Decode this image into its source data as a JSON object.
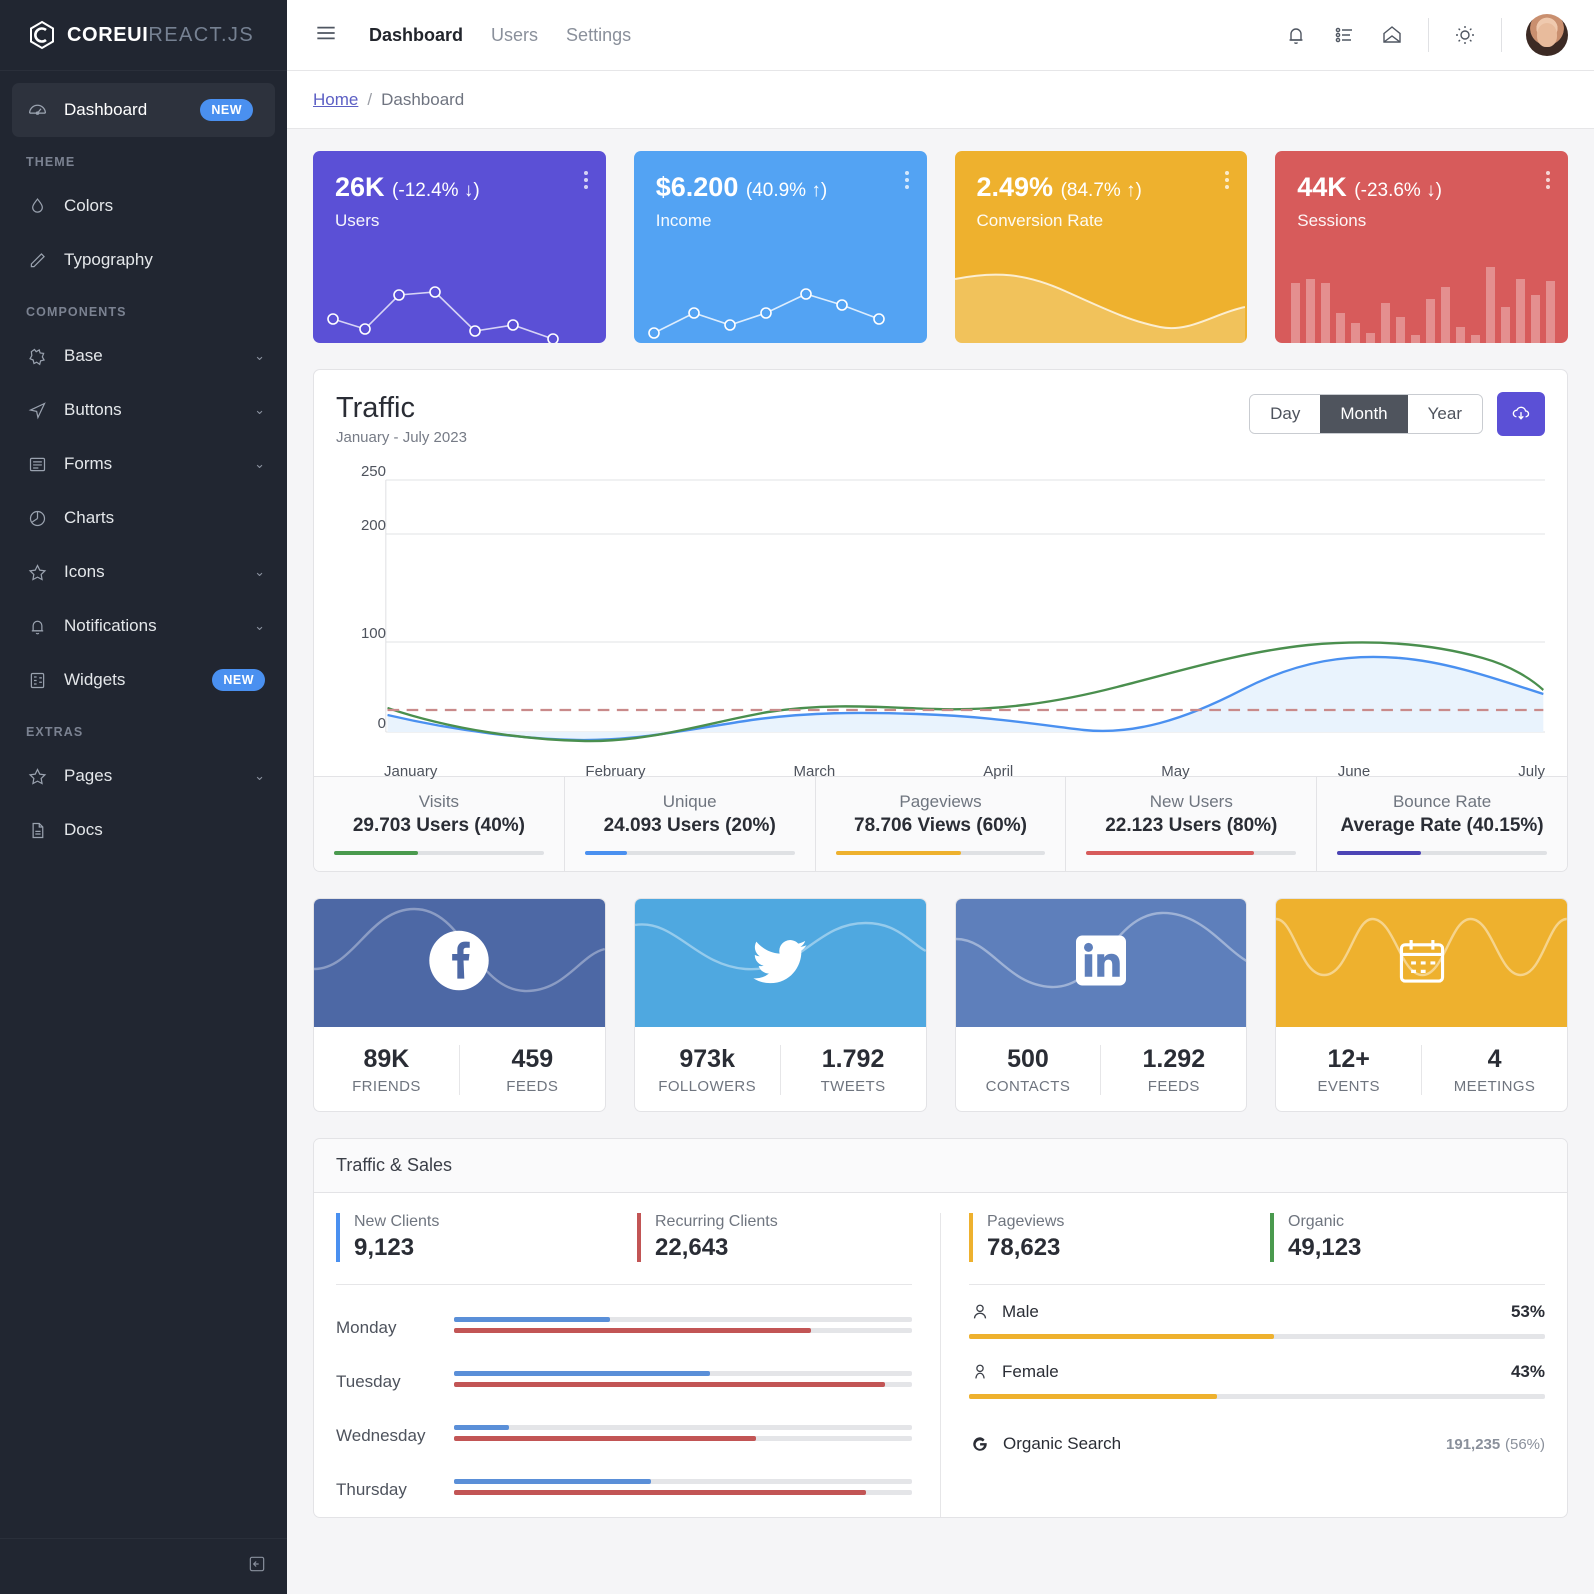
{
  "sidebar": {
    "brand": {
      "core": "COREUI",
      "react": "REACT.JS",
      "logo_icon": "coreui-hexagon-logo"
    },
    "primary": {
      "label": "Dashboard",
      "badge": "NEW",
      "icon": "speedometer-icon"
    },
    "sections": [
      {
        "title": "THEME",
        "items": [
          {
            "label": "Colors",
            "icon": "droplet-icon",
            "chevron": false,
            "badge": null
          },
          {
            "label": "Typography",
            "icon": "pencil-icon",
            "chevron": false,
            "badge": null
          }
        ]
      },
      {
        "title": "COMPONENTS",
        "items": [
          {
            "label": "Base",
            "icon": "puzzle-icon",
            "chevron": true,
            "badge": null
          },
          {
            "label": "Buttons",
            "icon": "cursor-icon",
            "chevron": true,
            "badge": null
          },
          {
            "label": "Forms",
            "icon": "notes-icon",
            "chevron": true,
            "badge": null
          },
          {
            "label": "Charts",
            "icon": "pie-chart-icon",
            "chevron": false,
            "badge": null
          },
          {
            "label": "Icons",
            "icon": "star-icon",
            "chevron": true,
            "badge": null
          },
          {
            "label": "Notifications",
            "icon": "bell-icon",
            "chevron": true,
            "badge": null
          },
          {
            "label": "Widgets",
            "icon": "calculator-icon",
            "chevron": false,
            "badge": "NEW"
          }
        ]
      },
      {
        "title": "EXTRAS",
        "items": [
          {
            "label": "Pages",
            "icon": "star-icon",
            "chevron": true,
            "badge": null
          },
          {
            "label": "Docs",
            "icon": "file-icon",
            "chevron": false,
            "badge": null
          }
        ]
      }
    ],
    "collapse_icon": "collapse-sidebar-icon"
  },
  "header": {
    "menu_icon": "hamburger-menu-icon",
    "nav": [
      {
        "label": "Dashboard",
        "active": true
      },
      {
        "label": "Users",
        "active": false
      },
      {
        "label": "Settings",
        "active": false
      }
    ],
    "icons": [
      "bell-icon",
      "task-list-icon",
      "envelope-icon",
      "sun-icon"
    ],
    "avatar": "user-avatar"
  },
  "breadcrumb": {
    "home": "Home",
    "separator": "/",
    "current": "Dashboard"
  },
  "stat_cards": [
    {
      "value": "26K",
      "delta": "(-12.4% ↓)",
      "title": "Users",
      "color": "#5b50d6",
      "theme": "sc-purple",
      "menu_icon": "options-dots-icon"
    },
    {
      "value": "$6.200",
      "delta": "(40.9% ↑)",
      "title": "Income",
      "color": "#53a3f3",
      "theme": "sc-blue",
      "menu_icon": "options-dots-icon"
    },
    {
      "value": "2.49%",
      "delta": "(84.7% ↑)",
      "title": "Conversion Rate",
      "color": "#eeb12e",
      "theme": "sc-yellow",
      "menu_icon": "options-dots-icon"
    },
    {
      "value": "44K",
      "delta": "(-23.6% ↓)",
      "title": "Sessions",
      "color": "#d75b5b",
      "theme": "sc-red",
      "menu_icon": "options-dots-icon"
    }
  ],
  "traffic": {
    "title": "Traffic",
    "subtitle": "January - July 2023",
    "range_buttons": [
      {
        "label": "Day",
        "active": false
      },
      {
        "label": "Month",
        "active": true
      },
      {
        "label": "Year",
        "active": false
      }
    ],
    "download_icon": "cloud-download-icon",
    "stats": [
      {
        "label": "Visits",
        "value": "29.703 Users (40%)",
        "color": "#4a9a4e",
        "pct": 40
      },
      {
        "label": "Unique",
        "value": "24.093 Users (20%)",
        "color": "#4a90f0",
        "pct": 20
      },
      {
        "label": "Pageviews",
        "value": "78.706 Views (60%)",
        "color": "#eeb12e",
        "pct": 60
      },
      {
        "label": "New Users",
        "value": "22.123 Users (80%)",
        "color": "#d75b5b",
        "pct": 80
      },
      {
        "label": "Bounce Rate",
        "value": "Average Rate (40.15%)",
        "color": "#4c44b5",
        "pct": 40
      }
    ]
  },
  "chart_data": {
    "type": "line",
    "title": "Traffic",
    "subtitle": "January - July 2023",
    "xlabel": "",
    "ylabel": "",
    "ylim": [
      0,
      250
    ],
    "yticks": [
      0,
      100,
      200,
      250
    ],
    "grid": true,
    "legend": "none",
    "categories": [
      "January",
      "February",
      "March",
      "April",
      "May",
      "June",
      "July"
    ],
    "series": [
      {
        "name": "series-1",
        "color": "#4a90f0",
        "fill": "#e8f2fd",
        "values": [
          57,
          12,
          30,
          52,
          28,
          78,
          40
        ]
      },
      {
        "name": "series-2",
        "color": "#4a8f4e",
        "fill": "none",
        "values": [
          70,
          15,
          55,
          56,
          80,
          93,
          65
        ]
      },
      {
        "name": "series-3",
        "color": "#c98a8a",
        "fill": "none",
        "style": "dashed",
        "values": [
          66,
          66,
          66,
          66,
          66,
          66,
          66
        ]
      }
    ]
  },
  "social": [
    {
      "network": "facebook",
      "icon": "facebook-icon",
      "color": "#4d68a5",
      "cells": [
        {
          "num": "89K",
          "cap": "FRIENDS"
        },
        {
          "num": "459",
          "cap": "FEEDS"
        }
      ]
    },
    {
      "network": "twitter",
      "icon": "twitter-icon",
      "color": "#4fa8e0",
      "cells": [
        {
          "num": "973k",
          "cap": "FOLLOWERS"
        },
        {
          "num": "1.792",
          "cap": "TWEETS"
        }
      ]
    },
    {
      "network": "linkedin",
      "icon": "linkedin-icon",
      "color": "#5e7fbb",
      "cells": [
        {
          "num": "500",
          "cap": "CONTACTS"
        },
        {
          "num": "1.292",
          "cap": "FEEDS"
        }
      ]
    },
    {
      "network": "calendar",
      "icon": "calendar-icon",
      "color": "#eeb12e",
      "cells": [
        {
          "num": "12+",
          "cap": "EVENTS"
        },
        {
          "num": "4",
          "cap": "MEETINGS"
        }
      ]
    }
  ],
  "traffic_sales": {
    "title": "Traffic & Sales",
    "mini_stats": [
      {
        "label": "New Clients",
        "value": "9,123",
        "color": "#4a90f0"
      },
      {
        "label": "Recurring Clients",
        "value": "22,643",
        "color": "#c25555"
      },
      {
        "label": "Pageviews",
        "value": "78,623",
        "color": "#eeb12e"
      },
      {
        "label": "Organic",
        "value": "49,123",
        "color": "#4a9a4e"
      }
    ],
    "days": [
      {
        "name": "Monday",
        "blue": 34,
        "red": 78
      },
      {
        "name": "Tuesday",
        "blue": 56,
        "red": 94
      },
      {
        "name": "Wednesday",
        "blue": 12,
        "red": 66
      },
      {
        "name": "Thursday",
        "blue": 43,
        "red": 90
      }
    ],
    "genders": [
      {
        "label": "Male",
        "icon": "male-user-icon",
        "pct": "53%",
        "bar": 53
      },
      {
        "label": "Female",
        "icon": "female-user-icon",
        "pct": "43%",
        "bar": 43
      }
    ],
    "sources": [
      {
        "label": "Organic Search",
        "icon": "google-g-icon",
        "value": "191,235",
        "pct": "(56%)"
      }
    ]
  }
}
